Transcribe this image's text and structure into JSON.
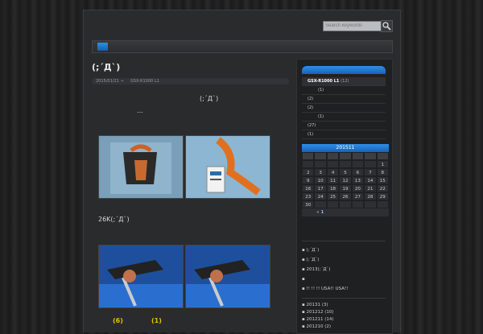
{
  "search": {
    "placeholder": "Search keywords"
  },
  "post": {
    "title": "(;´Д`)",
    "date": "2015/01/21",
    "date_suffix": "→",
    "category": "GSX-R1000 L1",
    "line1": "(;´Д`)",
    "line2": "…",
    "line3": "26K(;´Д`)",
    "footer_left": "(6)",
    "footer_right": "(1)"
  },
  "sidebar": {
    "categories": [
      {
        "label": "GSX-R1000 L1",
        "count": "(12)"
      },
      {
        "label": "",
        "count": "(1)"
      },
      {
        "label": "",
        "count": "(2)"
      },
      {
        "label": "",
        "count": "(2)"
      },
      {
        "label": "",
        "count": "(1)"
      },
      {
        "label": "",
        "count": "(27)"
      },
      {
        "label": "",
        "count": "(1)"
      }
    ],
    "calendar": {
      "title": "201511",
      "days": [
        "",
        "",
        "",
        "",
        "",
        "",
        "1",
        "2",
        "3",
        "4",
        "5",
        "6",
        "7",
        "8",
        "9",
        "10",
        "11",
        "12",
        "13",
        "14",
        "15",
        "16",
        "17",
        "18",
        "19",
        "20",
        "21",
        "22",
        "23",
        "24",
        "25",
        "26",
        "27",
        "28",
        "29",
        "30",
        "",
        "",
        "",
        "",
        "",
        ""
      ],
      "prev": "« 1"
    },
    "recent": [
      "(;´Д`)",
      "(;´Д`)",
      "2013(;´Д`)",
      "",
      "!! !! !! USA!! USA!!"
    ],
    "archives": [
      "20131 (3)",
      "201212 (10)",
      "201211 (14)",
      "201210 (2)"
    ]
  },
  "colors": {
    "accent": "#1f74cc",
    "footer_highlight": "#e8c000"
  }
}
